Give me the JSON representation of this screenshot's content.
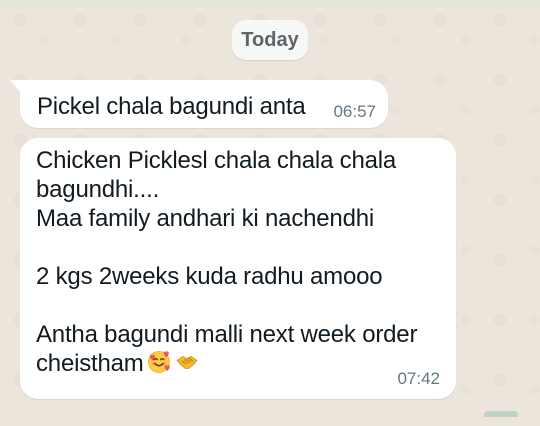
{
  "date_chip": {
    "label": "Today"
  },
  "messages": [
    {
      "text": "Pickel chala bagundi anta",
      "time": "06:57"
    },
    {
      "lines": [
        "Chicken Picklesl chala chala chala",
        "bagundhi....",
        "Maa family andhari ki nachendhi",
        "",
        "2 kgs 2weeks kuda radhu amooo",
        "",
        "Antha bagundi malli next week order",
        "cheistham"
      ],
      "emojis": [
        "smiling-face-with-hearts-icon",
        "handshake-icon"
      ],
      "time": "07:42"
    }
  ]
}
